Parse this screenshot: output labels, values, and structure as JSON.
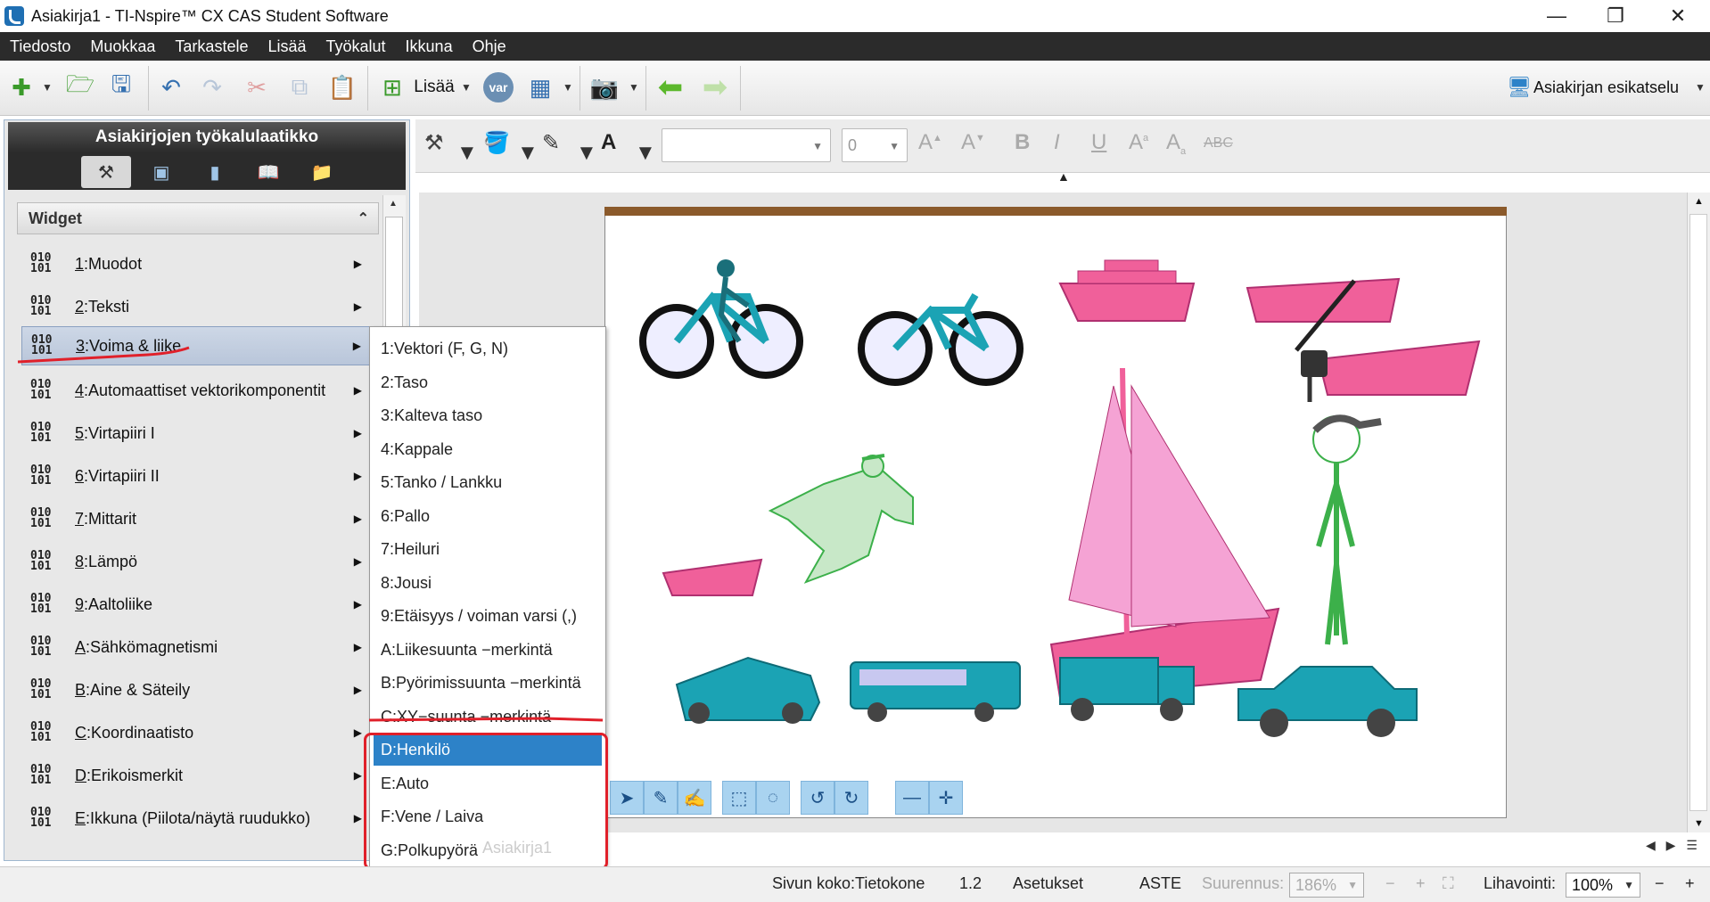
{
  "window": {
    "title": "Asiakirja1 - TI-Nspire™ CX CAS Student Software",
    "minimize": "—",
    "maximize": "❐",
    "close": "✕"
  },
  "menubar": [
    "Tiedosto",
    "Muokkaa",
    "Tarkastele",
    "Lisää",
    "Työkalut",
    "Ikkuna",
    "Ohje"
  ],
  "toolbar": {
    "insert_label": "Lisää",
    "var_label": "var",
    "preview_label": "Asiakirjan esikatselu"
  },
  "toolbox": {
    "title": "Asiakirjojen työkalulaatikko",
    "section": "Widget",
    "items": [
      {
        "key": "1",
        "label": "Muodot"
      },
      {
        "key": "2",
        "label": "Teksti"
      },
      {
        "key": "3",
        "label": "Voima & liike"
      },
      {
        "key": "4",
        "label": "Automaattiset vektorikomponentit"
      },
      {
        "key": "5",
        "label": "Virtapiiri I"
      },
      {
        "key": "6",
        "label": "Virtapiiri II"
      },
      {
        "key": "7",
        "label": "Mittarit"
      },
      {
        "key": "8",
        "label": "Lämpö"
      },
      {
        "key": "9",
        "label": "Aaltoliike"
      },
      {
        "key": "A",
        "label": "Sähkömagnetismi"
      },
      {
        "key": "B",
        "label": "Aine & Säteily"
      },
      {
        "key": "C",
        "label": "Koordinaatisto"
      },
      {
        "key": "D",
        "label": "Erikoismerkit"
      },
      {
        "key": "E",
        "label": "Ikkuna (Piilota/näytä ruudukko)"
      }
    ],
    "binary_top": "010",
    "binary_bottom": "101"
  },
  "submenu": [
    "1:Vektori (F, G, N)",
    "2:Taso",
    "3:Kalteva taso",
    "4:Kappale",
    "5:Tanko / Lankku",
    "6:Pallo",
    "7:Heiluri",
    "8:Jousi",
    "9:Etäisyys / voiman varsi (,)",
    "A:Liikesuunta −merkintä",
    "B:Pyörimissuunta −merkintä",
    "C:XY−suunta −merkintä",
    "D:Henkilö",
    "E:Auto",
    "F:Vene / Laiva",
    "G:Polkupyörä"
  ],
  "format": {
    "font_size": "0"
  },
  "tab_hidden": "Asiakirja1",
  "status": {
    "page_size": "Sivun koko:Tietokone",
    "version": "1.2",
    "settings": "Asetukset",
    "angle": "ASTE",
    "zoom_label": "Suurennus:",
    "zoom_value": "186%",
    "scale_label": "Lihavointi:",
    "scale_value": "100%"
  },
  "colors": {
    "menubar": "#2b2b2b",
    "highlight": "#2d82c8",
    "annotation": "#e0202a",
    "pink": "#f0609a",
    "teal": "#1ba3b4"
  }
}
